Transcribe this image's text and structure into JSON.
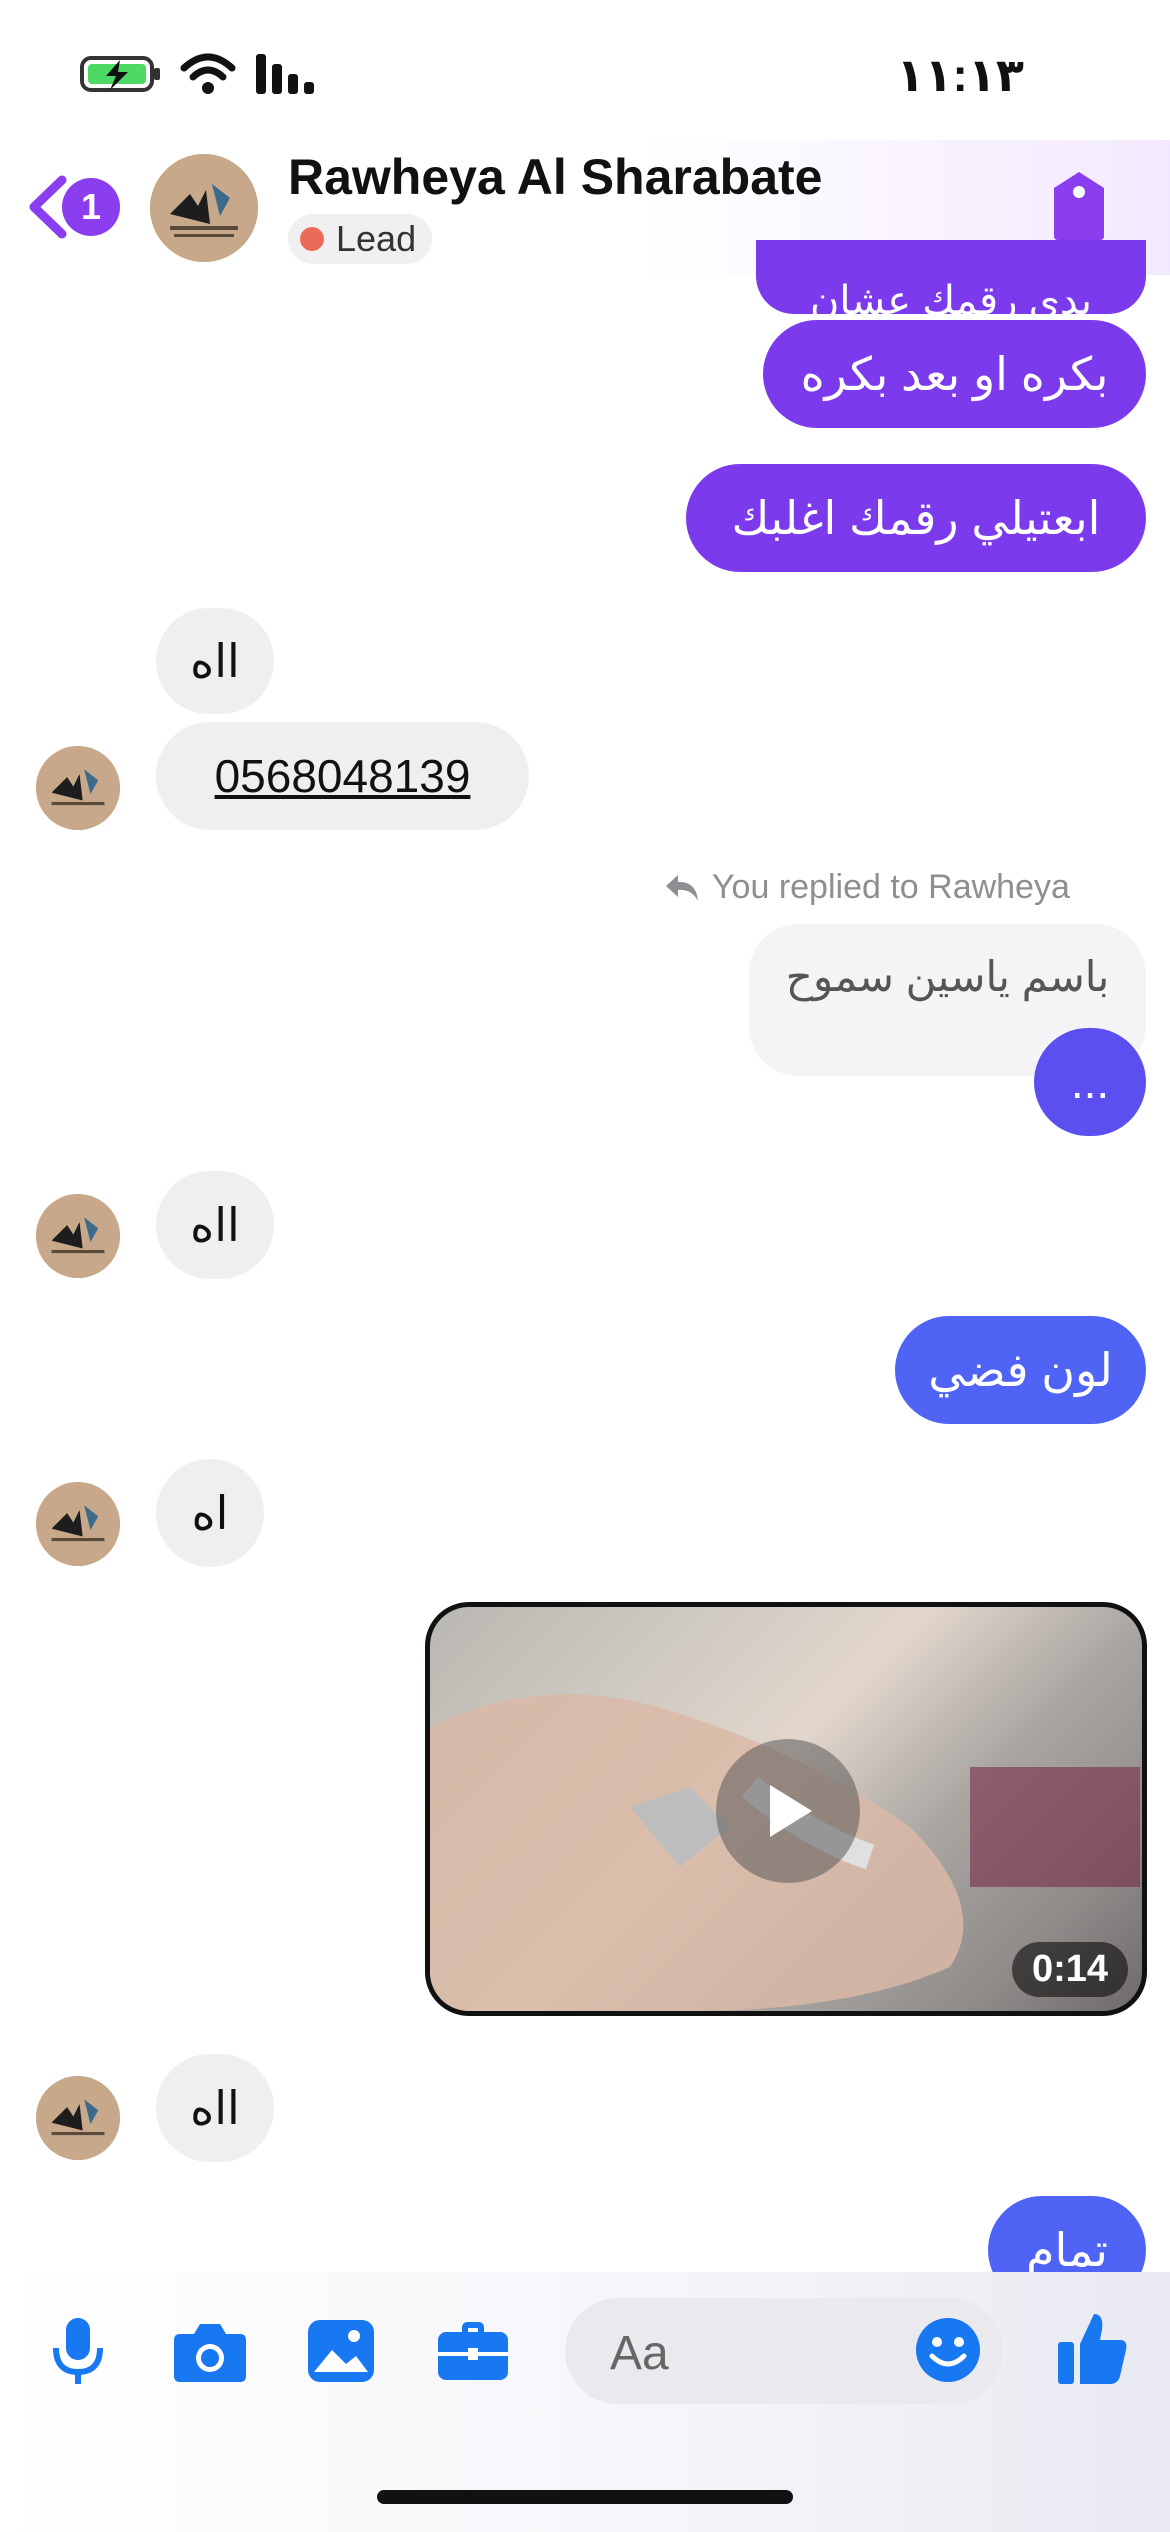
{
  "status": {
    "time": "١١:١٣"
  },
  "header": {
    "back_count": "1",
    "contact_name": "Rawheya Al Sharabate",
    "label": "Lead"
  },
  "messages": {
    "out_top_partial": "بدي رقمك عشان",
    "out_1": "بكره او بعد بكره",
    "out_2": "ابعتيلي رقمك اغلبك",
    "in_1": "ااه",
    "in_phone": "0568048139",
    "reply_note": "You replied to Rawheya",
    "reply_quote": "باسم ياسين سموح",
    "reply_text": "...",
    "in_2": "ااه",
    "out_3": "لون فضي",
    "in_3": "اه",
    "video_duration": "0:14",
    "in_4": "ااه",
    "out_4": "تمام"
  },
  "composer": {
    "placeholder": "Aa"
  },
  "colors": {
    "accent": "#7c3aed",
    "blue": "#4f63f5",
    "incoming": "#efefef",
    "lead_dot": "#ec6a58"
  }
}
